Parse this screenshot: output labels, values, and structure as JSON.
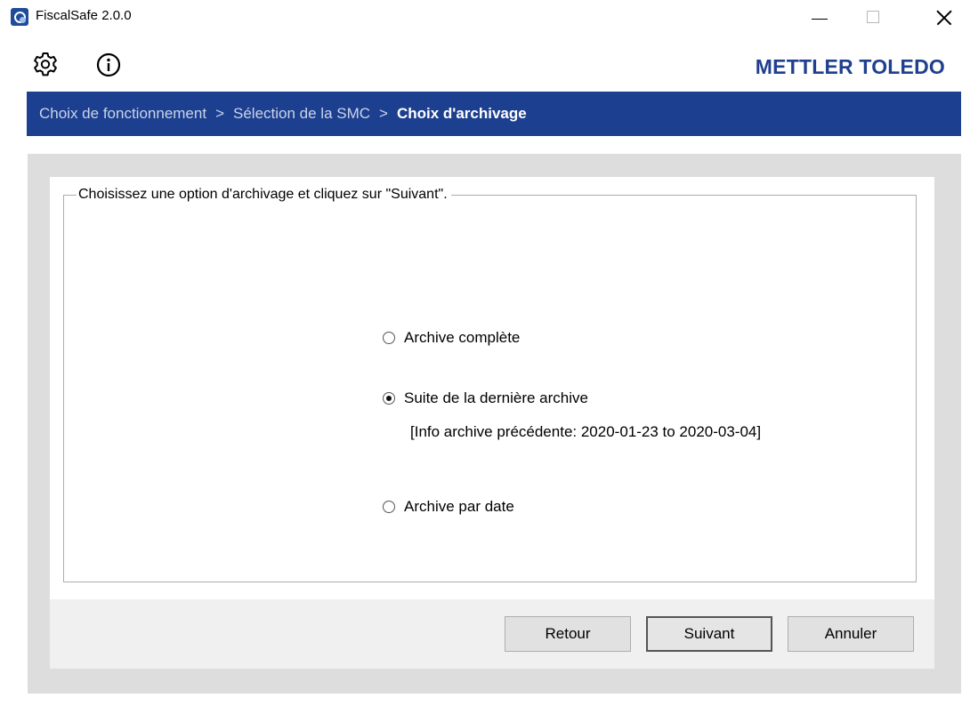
{
  "window": {
    "title": "FiscalSafe 2.0.0",
    "icon": "fiscalsafe-app-icon",
    "controls": [
      "minimize",
      "maximize",
      "close"
    ]
  },
  "toolbar": {
    "settings_icon": "gear-icon",
    "info_icon": "info-circle-icon",
    "brand": "METTLER TOLEDO",
    "brand_color": "#1f3f8f"
  },
  "breadcrumb": {
    "items": [
      "Choix de fonctionnement",
      "Sélection de la SMC",
      "Choix d'archivage"
    ],
    "separator": ">",
    "background": "#1d3f8f"
  },
  "group": {
    "legend": "Choisissez une option d'archivage et cliquez sur \"Suivant\"."
  },
  "options": [
    {
      "label": "Archive complète",
      "checked": false
    },
    {
      "label": "Suite de la dernière archive",
      "checked": true
    },
    {
      "label": "Archive par date",
      "checked": false
    }
  ],
  "previous_info": "[Info archive précédente: 2020-01-23 to 2020-03-04]",
  "buttons": {
    "back": "Retour",
    "next": "Suivant",
    "cancel": "Annuler"
  }
}
